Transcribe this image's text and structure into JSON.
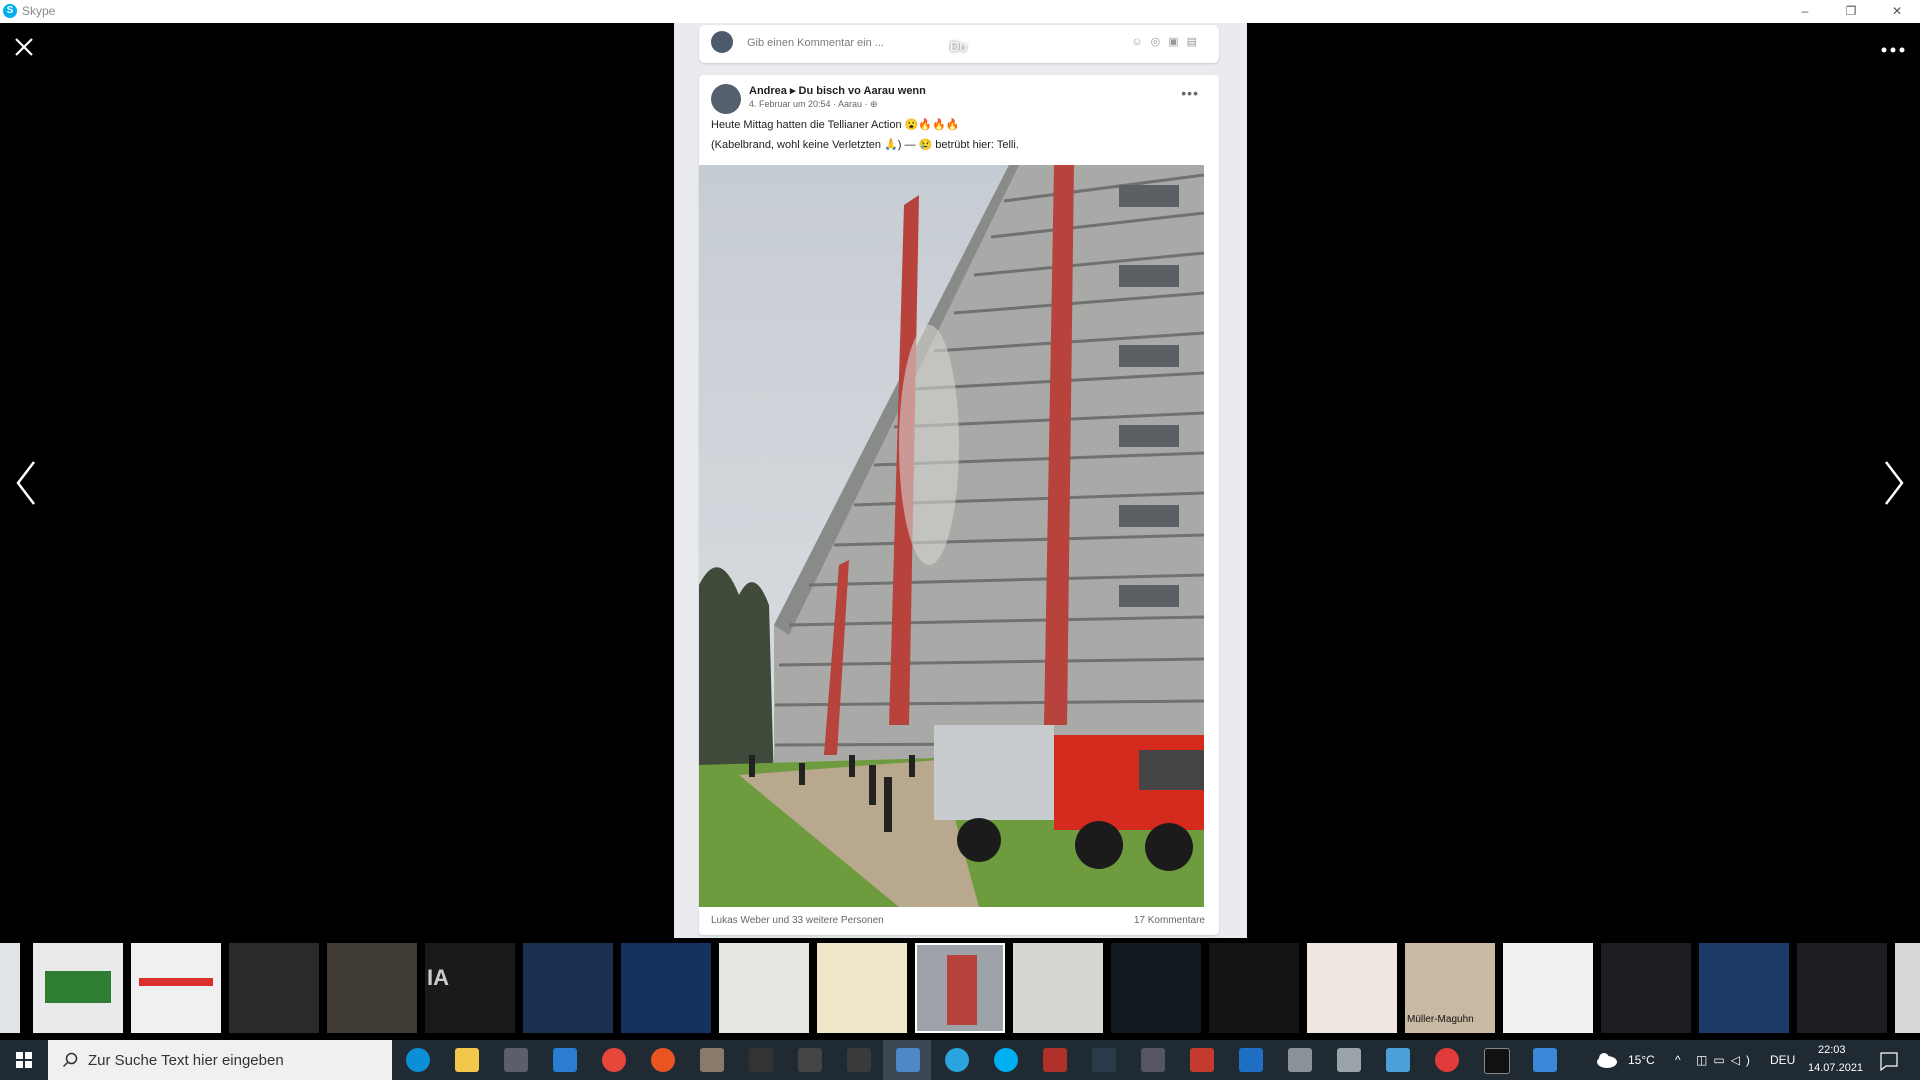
{
  "window": {
    "title": "Skype",
    "app_icon": "skype-icon",
    "minimize": "–",
    "restore": "❐",
    "close": "✕"
  },
  "viewer": {
    "close_icon": "close-icon",
    "more_icon": "more-icon",
    "prev_icon": "chevron-left-icon",
    "next_icon": "chevron-right-icon",
    "sender_label": "Du"
  },
  "comment_box": {
    "placeholder": "Gib einen Kommentar ein ..."
  },
  "post": {
    "author": "Andrea ▸ Du bisch vo Aarau wenn",
    "meta": "4. Februar um 20:54 · Aarau · ⊕",
    "more": "•••",
    "line1": "Heute Mittag hatten die Tellianer Action 😮🔥🔥🔥",
    "line2": "(Kabelbrand, wohl keine Verletzten 🙏) — 😢 betrübt hier: Telli.",
    "reactions": "Lukas Weber und 33 weitere Personen",
    "comments": "17 Kommentare"
  },
  "thumbnails": [
    {
      "label": ""
    },
    {
      "label": ""
    },
    {
      "label": ""
    },
    {
      "label": ""
    },
    {
      "label": ""
    },
    {
      "label": "IA"
    },
    {
      "label": ""
    },
    {
      "label": ""
    },
    {
      "label": ""
    },
    {
      "label": ""
    },
    {
      "label": ""
    },
    {
      "label": ""
    },
    {
      "label": ""
    },
    {
      "label": ""
    },
    {
      "label": ""
    },
    {
      "label": "Müller-Maguhn"
    },
    {
      "label": ""
    },
    {
      "label": ""
    },
    {
      "label": ""
    },
    {
      "label": ""
    }
  ],
  "taskbar": {
    "search_placeholder": "Zur Suche Text hier eingeben",
    "weather": "15°C",
    "language": "DEU",
    "time": "22:03",
    "date": "14.07.2021",
    "apps": [
      "edge-icon",
      "explorer-icon",
      "store-icon",
      "mail-icon",
      "chrome-icon",
      "ubuntu-icon",
      "app-icon",
      "app-icon",
      "app-icon",
      "live-icon",
      "skype-viewer-icon",
      "telegram-icon",
      "skype-icon",
      "app-icon",
      "kali-icon",
      "app-icon",
      "weather-app-icon",
      "app-icon",
      "app-icon",
      "app-icon",
      "app-icon",
      "app-icon",
      "terminal-icon",
      "app-icon"
    ]
  },
  "colors": {
    "accent": "#00aff0",
    "taskbar": "#1f2a33",
    "fire_truck": "#d52a1e"
  }
}
